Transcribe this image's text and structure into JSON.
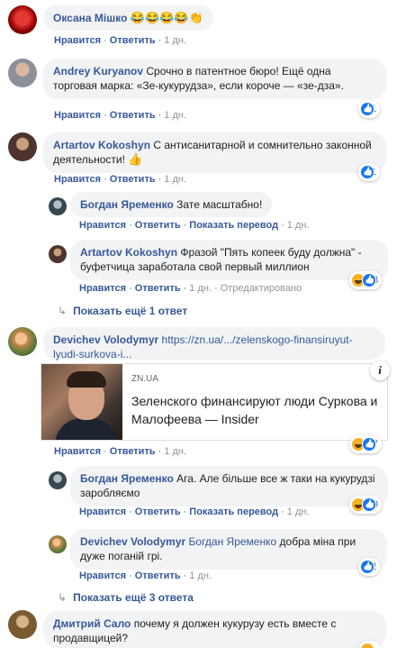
{
  "actions": {
    "like": "Нравится",
    "reply": "Ответить",
    "translate": "Показать перевод",
    "edited": "Отредактировано",
    "time": "1 дн."
  },
  "comments": [
    {
      "author": "Оксана Мішко",
      "emoji": "😂😂😂😂👏",
      "avatar_color": "#c0392b"
    },
    {
      "author": "Andrey Kuryanov",
      "text": "Срочно в патентное бюро! Ещё одна торговая марка: «Зе-кукурудза», если короче — «зе-дза».",
      "reactions_count": "1",
      "avatar_color": "#7f8c8d"
    },
    {
      "author": "Artartov Kokoshyn",
      "text": "С антисанитарной и сомнительно законной деятельности!",
      "emoji": "👍",
      "reactions_count": "1",
      "avatar_color": "#6d4c41",
      "replies": [
        {
          "author": "Богдан Яременко",
          "text": "Зате масштабно!",
          "avatar_color": "#455a64"
        },
        {
          "author": "Artartov Kokoshyn",
          "text": "Фразой \"Пять копеек буду должна\" - буфетчица заработала свой первый миллион",
          "reactions_count": "3",
          "avatar_color": "#6d4c41"
        }
      ],
      "show_more": "Показать ещё 1 ответ"
    },
    {
      "author": "Devichev Volodymyr",
      "link": "https://zn.ua/.../zelenskogo-finansiruyut-lyudi-surkova-i...",
      "card": {
        "domain": "ZN.UA",
        "title": "Зеленского финансируют люди Суркова и Малофеева — Insider"
      },
      "reactions_count": "7",
      "avatar_color": "#b58c5a",
      "replies": [
        {
          "author": "Богдан Яременко",
          "text": "Ага. Але більше все ж таки на кукурудзі заробляємо",
          "reactions_count": "9",
          "avatar_color": "#455a64"
        },
        {
          "author": "Devichev Volodymyr",
          "mention": "Богдан Яременко",
          "text": "добра міна при дуже поганій грі.",
          "reactions_count": "2",
          "avatar_color": "#b58c5a"
        }
      ],
      "show_more": "Показать ещё 3 ответа"
    },
    {
      "author": "Дмитрий Сало",
      "text": "почему я должен кукурузу есть вместе с продавщицей?",
      "avatar_color": "#8d6e3a"
    }
  ],
  "colors": {
    "link": "#385898",
    "bubble": "#f2f3f5",
    "like_blue": "#1877f2",
    "haha_yellow": "#f7b125"
  }
}
